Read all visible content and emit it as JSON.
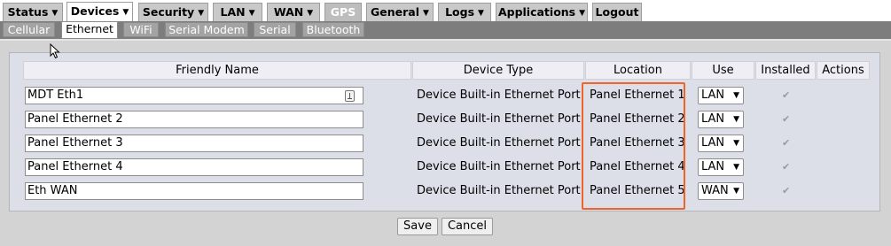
{
  "nav": {
    "tabs": [
      {
        "label": "Status",
        "caret": "▼"
      },
      {
        "label": "Devices",
        "caret": "▼"
      },
      {
        "label": "Security",
        "caret": "▼"
      },
      {
        "label": "LAN",
        "caret": "▼"
      },
      {
        "label": "WAN",
        "caret": "▼"
      },
      {
        "label": "GPS",
        "caret": ""
      },
      {
        "label": "General",
        "caret": "▼"
      },
      {
        "label": "Logs",
        "caret": "▼"
      },
      {
        "label": "Applications",
        "caret": "▼"
      },
      {
        "label": "Logout",
        "caret": ""
      }
    ],
    "active": "Devices"
  },
  "subnav": {
    "tabs": [
      "Cellular",
      "Ethernet",
      "WiFi",
      "Serial Modem",
      "Serial",
      "Bluetooth"
    ],
    "active": "Ethernet"
  },
  "table": {
    "headers": {
      "name": "Friendly Name",
      "type": "Device Type",
      "location": "Location",
      "use": "Use",
      "installed": "Installed",
      "actions": "Actions"
    },
    "rows": [
      {
        "name": "MDT Eth1",
        "type": "Device Built-in Ethernet Port",
        "location": "Panel Ethernet 1",
        "use": "LAN",
        "installed": true
      },
      {
        "name": "Panel Ethernet 2",
        "type": "Device Built-in Ethernet Port",
        "location": "Panel Ethernet 2",
        "use": "LAN",
        "installed": true
      },
      {
        "name": "Panel Ethernet 3",
        "type": "Device Built-in Ethernet Port",
        "location": "Panel Ethernet 3",
        "use": "LAN",
        "installed": true
      },
      {
        "name": "Panel Ethernet 4",
        "type": "Device Built-in Ethernet Port",
        "location": "Panel Ethernet 4",
        "use": "LAN",
        "installed": true
      },
      {
        "name": "Eth WAN",
        "type": "Device Built-in Ethernet Port",
        "location": "Panel Ethernet 5",
        "use": "WAN",
        "installed": true
      }
    ],
    "select_caret": "▼"
  },
  "buttons": {
    "save": "Save",
    "cancel": "Cancel"
  },
  "colors": {
    "highlight": "#f0642b"
  }
}
